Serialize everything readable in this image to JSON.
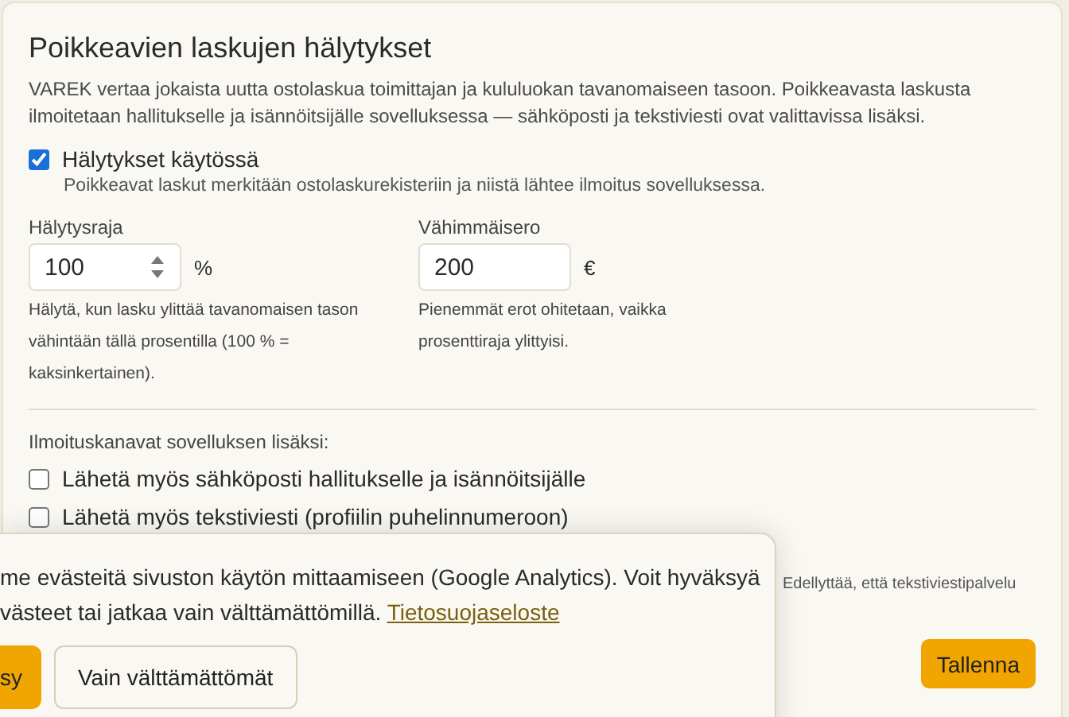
{
  "title": "Poikkeavien laskujen hälytykset",
  "description": "VAREK vertaa jokaista uutta ostolaskua toimittajan ja kululuokan tavanomaiseen tasoon. Poikkeavasta laskusta ilmoitetaan hallitukselle ja isännöitsijälle sovelluksessa — sähköposti ja tekstiviesti ovat valittavissa lisäksi.",
  "enabled": {
    "label": "Hälytykset käytössä",
    "checked": true,
    "hint": "Poikkeavat laskut merkitään ostolaskurekisteriin ja niistä lähtee ilmoitus sovelluksessa."
  },
  "fields": [
    {
      "label": "Hälytysraja",
      "value": "100",
      "unit": "%",
      "kind": "spinner",
      "help": "Hälytä, kun lasku ylittää tavanomaisen tason vähintään tällä prosentilla (100 % = kaksinkertainen)."
    },
    {
      "label": "Vähimmäisero",
      "value": "200",
      "unit": "€",
      "kind": "text",
      "help": "Pienemmät erot ohitetaan, vaikka prosenttiraja ylittyisi."
    }
  ],
  "channels_heading": "Ilmoituskanavat sovelluksen lisäksi:",
  "channels": [
    {
      "label": "Lähetä myös sähköposti hallitukselle ja isännöitsijälle",
      "checked": false
    },
    {
      "label": "Lähetä myös tekstiviesti (profiilin puhelinnumeroon)",
      "checked": false,
      "hint": "Edellyttää, että tekstiviestipalvelu"
    }
  ],
  "save_button": "Tallenna",
  "cookie_banner": {
    "lines": [
      "me evästeitä sivuston käytön mittaamiseen (Google Analytics). Voit hyväksyä",
      "västeet tai jatkaa vain välttämättömillä."
    ],
    "link": "Tietosuojaseloste",
    "buttons": [
      {
        "label": "sy",
        "kind": "primary"
      },
      {
        "label": "Vain välttämättömät",
        "kind": "secondary"
      }
    ]
  }
}
